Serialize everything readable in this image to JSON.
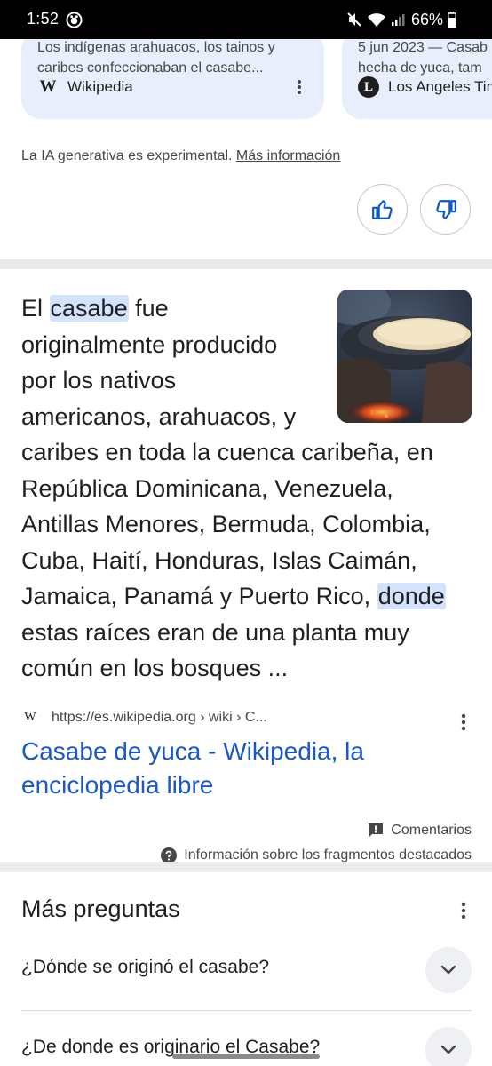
{
  "status_bar": {
    "time": "1:52",
    "battery": "66%"
  },
  "cards": [
    {
      "snippet_line1": "Los indígenas arahuacos, los tainos y",
      "snippet_line2": "caribes confeccionaban el casabe...",
      "source_logo": "W",
      "source_name": "Wikipedia"
    },
    {
      "snippet_line1": "5 jun 2023 — Casab",
      "snippet_line2": "hecha de yuca, tam",
      "source_logo": "L",
      "source_name": "Los Angeles Tim"
    }
  ],
  "ai_notice": {
    "text": "La IA generativa es experimental. ",
    "link": "Más información"
  },
  "featured_snippet": {
    "line1_pre": "El ",
    "line1_hl": "casabe",
    "line1_post": " fue",
    "line2": "originalmente producido",
    "line3": "por los nativos",
    "line4": "americanos, arahuacos, y",
    "line5": "caribes en toda la cuenca caribeña, en",
    "line6": "República Dominicana, Venezuela,",
    "line7": "Antillas Menores, Bermuda, Colombia,",
    "line8": "Cuba, Haití, Honduras, Islas Caimán,",
    "line9_pre": "Jamaica, Panamá y Puerto Rico, ",
    "line9_hl": "donde",
    "line10": "estas raíces eran de una planta muy",
    "line11": "común en los bosques ...",
    "source_favicon": "W",
    "source_url": "https://es.wikipedia.org › wiki › C...",
    "title_line1": "Casabe de yuca - Wikipedia, la",
    "title_line2": "enciclopedia libre",
    "feedback": "Comentarios",
    "info": "Información sobre los fragmentos destacados"
  },
  "more_questions": {
    "title": "Más preguntas",
    "items": [
      "¿Dónde se originó el casabe?",
      "¿De donde es originario el Casabe?"
    ]
  },
  "colors": {
    "link_blue": "#1a57c8",
    "highlight": "#d3e3fd",
    "card_bg": "#e8eefc"
  }
}
